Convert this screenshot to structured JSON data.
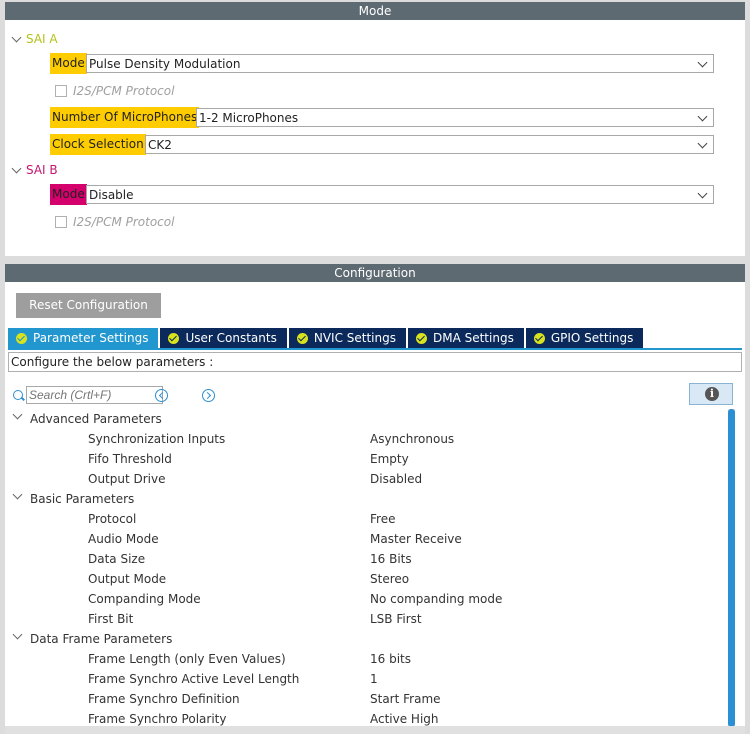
{
  "mode": {
    "header": "Mode",
    "sai_a": {
      "title": "SAI A",
      "mode_label": "Mode",
      "mode_value": "Pulse Density Modulation",
      "i2s_label": "I2S/PCM Protocol",
      "mic_label": "Number Of MicroPhones",
      "mic_value": "1-2 MicroPhones",
      "clock_label": "Clock Selection",
      "clock_value": "CK2"
    },
    "sai_b": {
      "title": "SAI B",
      "mode_label": "Mode",
      "mode_value": "Disable",
      "i2s_label": "I2S/PCM Protocol"
    }
  },
  "config": {
    "header": "Configuration",
    "reset_label": "Reset Configuration",
    "tabs": [
      {
        "label": "Parameter Settings"
      },
      {
        "label": "User Constants"
      },
      {
        "label": "NVIC Settings"
      },
      {
        "label": "DMA Settings"
      },
      {
        "label": "GPIO Settings"
      }
    ],
    "description": "Configure the below parameters :",
    "search_placeholder": "Search (Crtl+F)",
    "groups": [
      {
        "title": "Advanced Parameters",
        "params": [
          {
            "key": "Synchronization Inputs",
            "value": "Asynchronous"
          },
          {
            "key": "Fifo Threshold",
            "value": "Empty"
          },
          {
            "key": "Output Drive",
            "value": "Disabled"
          }
        ]
      },
      {
        "title": "Basic Parameters",
        "params": [
          {
            "key": "Protocol",
            "value": "Free"
          },
          {
            "key": "Audio Mode",
            "value": "Master Receive"
          },
          {
            "key": "Data Size",
            "value": "16 Bits"
          },
          {
            "key": "Output Mode",
            "value": "Stereo"
          },
          {
            "key": "Companding Mode",
            "value": "No companding mode"
          },
          {
            "key": "First Bit",
            "value": "LSB First"
          }
        ]
      },
      {
        "title": "Data Frame Parameters",
        "params": [
          {
            "key": "Frame Length (only Even Values)",
            "value": "16 bits"
          },
          {
            "key": "Frame Synchro Active Level Length",
            "value": "1"
          },
          {
            "key": "Frame Synchro Definition",
            "value": "Start Frame"
          },
          {
            "key": "Frame Synchro Polarity",
            "value": "Active High"
          }
        ]
      }
    ]
  },
  "colors": {
    "header_bg": "#5e6a72",
    "highlight_yellow": "#ffcc00",
    "highlight_pink": "#d4006b",
    "tab_active": "#2196cf",
    "tab_inactive": "#0b2a5b",
    "sai_a_title": "#b5c21b",
    "sai_b_title": "#c2186f"
  },
  "icons": {
    "tab_status": "check-circle-icon",
    "search": "search-icon",
    "prev": "chevron-left-circle-icon",
    "next": "chevron-right-circle-icon",
    "info": "info-icon",
    "expand": "chevron-down-icon"
  }
}
